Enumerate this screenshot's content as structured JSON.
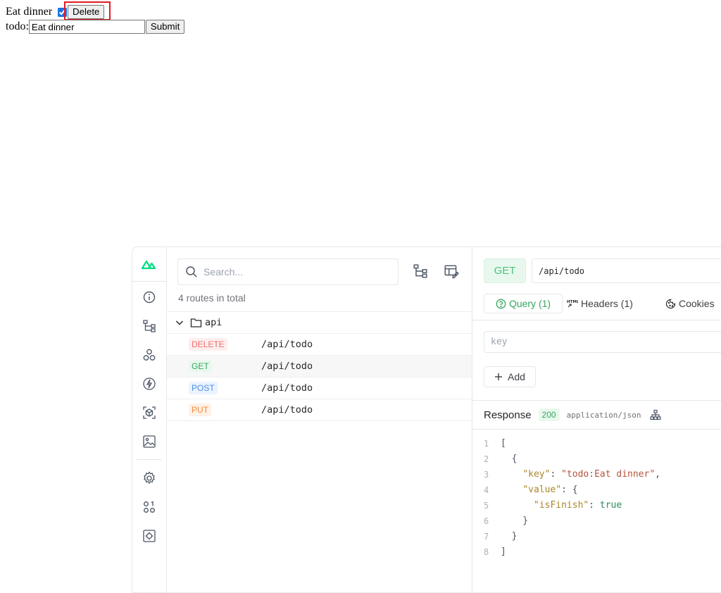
{
  "todo_page": {
    "item_text": "Eat dinner",
    "item_checked": true,
    "delete_label": "Delete",
    "form_label": "todo:",
    "input_value": "Eat dinner",
    "submit_label": "Submit"
  },
  "panel": {
    "search": {
      "placeholder": "Search..."
    },
    "routes_count": "4 routes in total",
    "folder": "api",
    "routes": [
      {
        "method": "DELETE",
        "path": "/api/todo"
      },
      {
        "method": "GET",
        "path": "/api/todo"
      },
      {
        "method": "POST",
        "path": "/api/todo"
      },
      {
        "method": "PUT",
        "path": "/api/todo"
      }
    ],
    "detail": {
      "method": "GET",
      "url": "/api/todo",
      "tabs": [
        "Query (1)",
        "Headers (1)",
        "Cookies"
      ],
      "key_placeholder": "key",
      "add_label": "Add",
      "response_label": "Response",
      "status": "200",
      "content_type": "application/json",
      "code_lines": [
        {
          "n": "1",
          "text": "["
        },
        {
          "n": "2",
          "text": "  {"
        },
        {
          "n": "3",
          "key": "\"key\"",
          "sep": ": ",
          "val": "\"todo:Eat dinner\"",
          "tail": ","
        },
        {
          "n": "4",
          "key": "\"value\"",
          "sep": ": ",
          "tail": "{"
        },
        {
          "n": "5",
          "key": "\"isFinish\"",
          "sep": ": ",
          "bool": "true"
        },
        {
          "n": "6",
          "text": "    }"
        },
        {
          "n": "7",
          "text": "  }"
        },
        {
          "n": "8",
          "text": "]"
        }
      ]
    }
  },
  "colors": {
    "accent_green": "#31a75c",
    "highlight_red": "#e01b24"
  }
}
